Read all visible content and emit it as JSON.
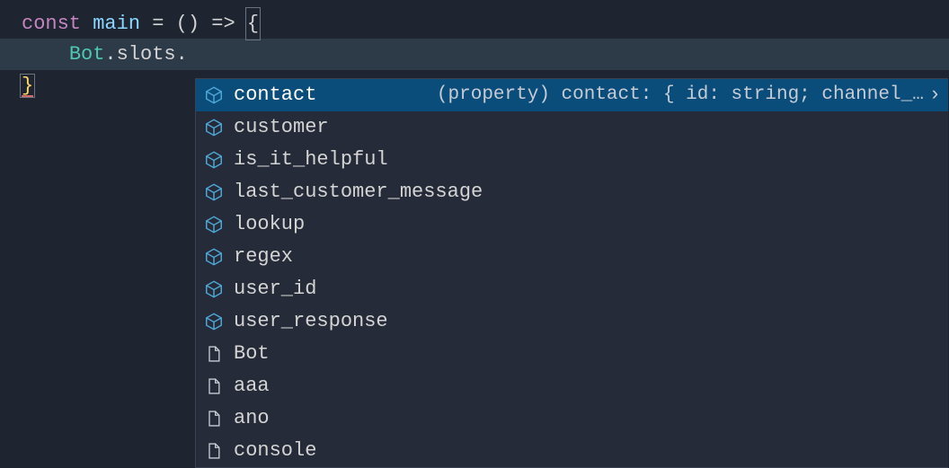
{
  "code": {
    "line1": {
      "keyword": "const",
      "ident": " main ",
      "eq": "=",
      "params": " () ",
      "arrow": "=>",
      "space": " ",
      "brace": "{"
    },
    "line2": {
      "indent": "    ",
      "obj": "Bot",
      "dot": ".",
      "prop": "slots",
      "dot2": "."
    },
    "line3": {
      "brace": "}"
    }
  },
  "autocomplete": {
    "items": [
      {
        "icon": "property",
        "label": "contact",
        "detail": "(property) contact: { id: string; channel_…",
        "selected": true,
        "showChevron": true
      },
      {
        "icon": "property",
        "label": "customer"
      },
      {
        "icon": "property",
        "label": "is_it_helpful"
      },
      {
        "icon": "property",
        "label": "last_customer_message"
      },
      {
        "icon": "property",
        "label": "lookup"
      },
      {
        "icon": "property",
        "label": "regex"
      },
      {
        "icon": "property",
        "label": "user_id"
      },
      {
        "icon": "property",
        "label": "user_response"
      },
      {
        "icon": "file",
        "label": "Bot"
      },
      {
        "icon": "file",
        "label": "aaa"
      },
      {
        "icon": "file",
        "label": "ano"
      },
      {
        "icon": "file",
        "label": "console"
      }
    ]
  },
  "icons": {
    "chevron": "›"
  }
}
